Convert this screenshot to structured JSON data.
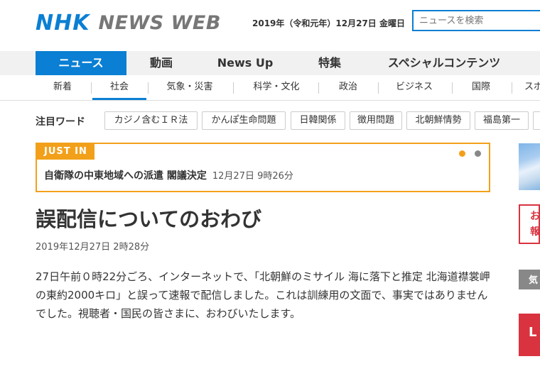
{
  "header": {
    "logo_nhk": "NHK",
    "logo_newsweb": "NEWS WEB",
    "date": "2019年（令和元年）12月27日 金曜日",
    "search_placeholder": "ニュースを検索"
  },
  "main_nav": {
    "items": [
      {
        "label": "ニュース"
      },
      {
        "label": "動画"
      },
      {
        "label": "News Up"
      },
      {
        "label": "特集"
      },
      {
        "label": "スペシャルコンテンツ"
      }
    ],
    "active_index": 0
  },
  "sub_nav": {
    "items": [
      {
        "label": "新着"
      },
      {
        "label": "社会"
      },
      {
        "label": "気象・災害"
      },
      {
        "label": "科学・文化"
      },
      {
        "label": "政治"
      },
      {
        "label": "ビジネス"
      },
      {
        "label": "国際"
      },
      {
        "label": "スポ"
      }
    ],
    "active_index": 1
  },
  "trend": {
    "label": "注目ワード",
    "chips": [
      {
        "label": "カジノ含むＩＲ法"
      },
      {
        "label": "かんぽ生命問題"
      },
      {
        "label": "日韓関係"
      },
      {
        "label": "徴用問題"
      },
      {
        "label": "北朝鮮情勢"
      },
      {
        "label": "福島第一"
      }
    ]
  },
  "just_in": {
    "tag": "JUST IN",
    "headline": "自衛隊の中東地域への派遣 閣議決定",
    "time": "12月27日 9時26分",
    "pager": {
      "active": 1,
      "total": 2
    }
  },
  "article": {
    "title": "誤配信についてのおわび",
    "date": "2019年12月27日 2時28分",
    "body": "27日午前０時22分ごろ、インターネットで、「北朝鮮のミサイル 海に落下と推定 北海道襟裳岬の東約2000キロ」と誤って速報で配信しました。これは訓練用の文面で、事実ではありませんでした。視聴者・国民の皆さまに、おわびいたします。"
  },
  "sidebar": {
    "red_box_text": "お\n報",
    "gray_box_text": "気",
    "red_banner_text": "L"
  },
  "colors": {
    "brand_blue": "#0a7fd3",
    "just_in_orange": "#f2a01a",
    "nav_background": "#f1f1f1",
    "alert_red": "#d9333f"
  }
}
